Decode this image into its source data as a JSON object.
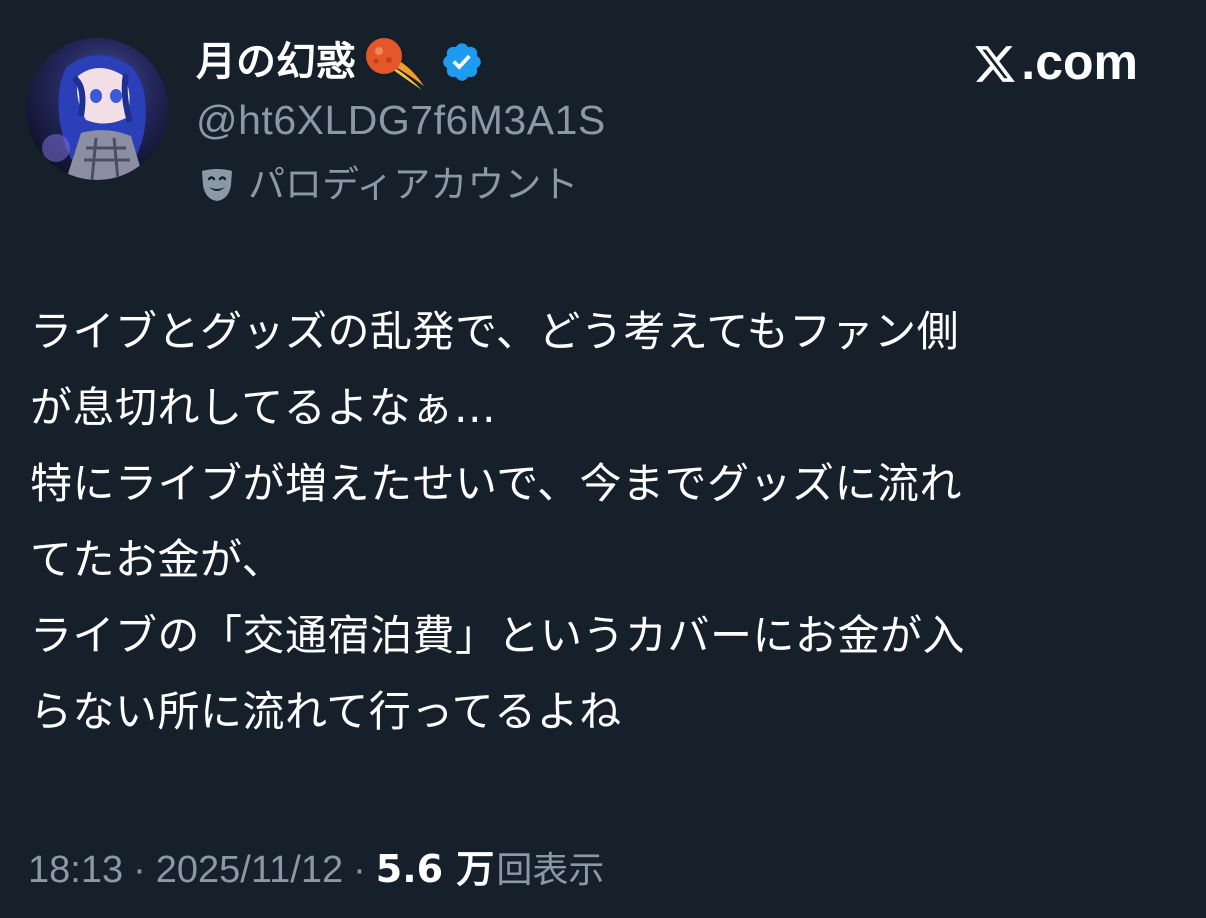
{
  "author": {
    "display_name": "月の幻惑",
    "emoji_icon": "comet-icon",
    "verified_icon": "verified-badge-icon",
    "handle": "@ht6XLDG7f6M3A1S",
    "parody_icon": "theater-mask-icon",
    "parody_label": "パロディアカウント"
  },
  "brand": {
    "text": ".com",
    "icon": "x-logo-icon"
  },
  "tweet": {
    "lines": [
      "ライブとグッズの乱発で、どう考えてもファン側",
      "が息切れしてるよなぁ…",
      "特にライブが増えたせいで、今までグッズに流れ",
      "てたお金が、",
      "ライブの「交通宿泊費」というカバーにお金が入",
      "らない所に流れて行ってるよね"
    ]
  },
  "meta": {
    "time": "18:13",
    "separator": "·",
    "date": "2025/11/12",
    "views_count": "5.6 万",
    "views_label": "回表示"
  },
  "colors": {
    "background": "#15202b",
    "primary_text": "#ffffff",
    "secondary_text": "#8b98a5",
    "verified_blue": "#1d9bf0"
  }
}
